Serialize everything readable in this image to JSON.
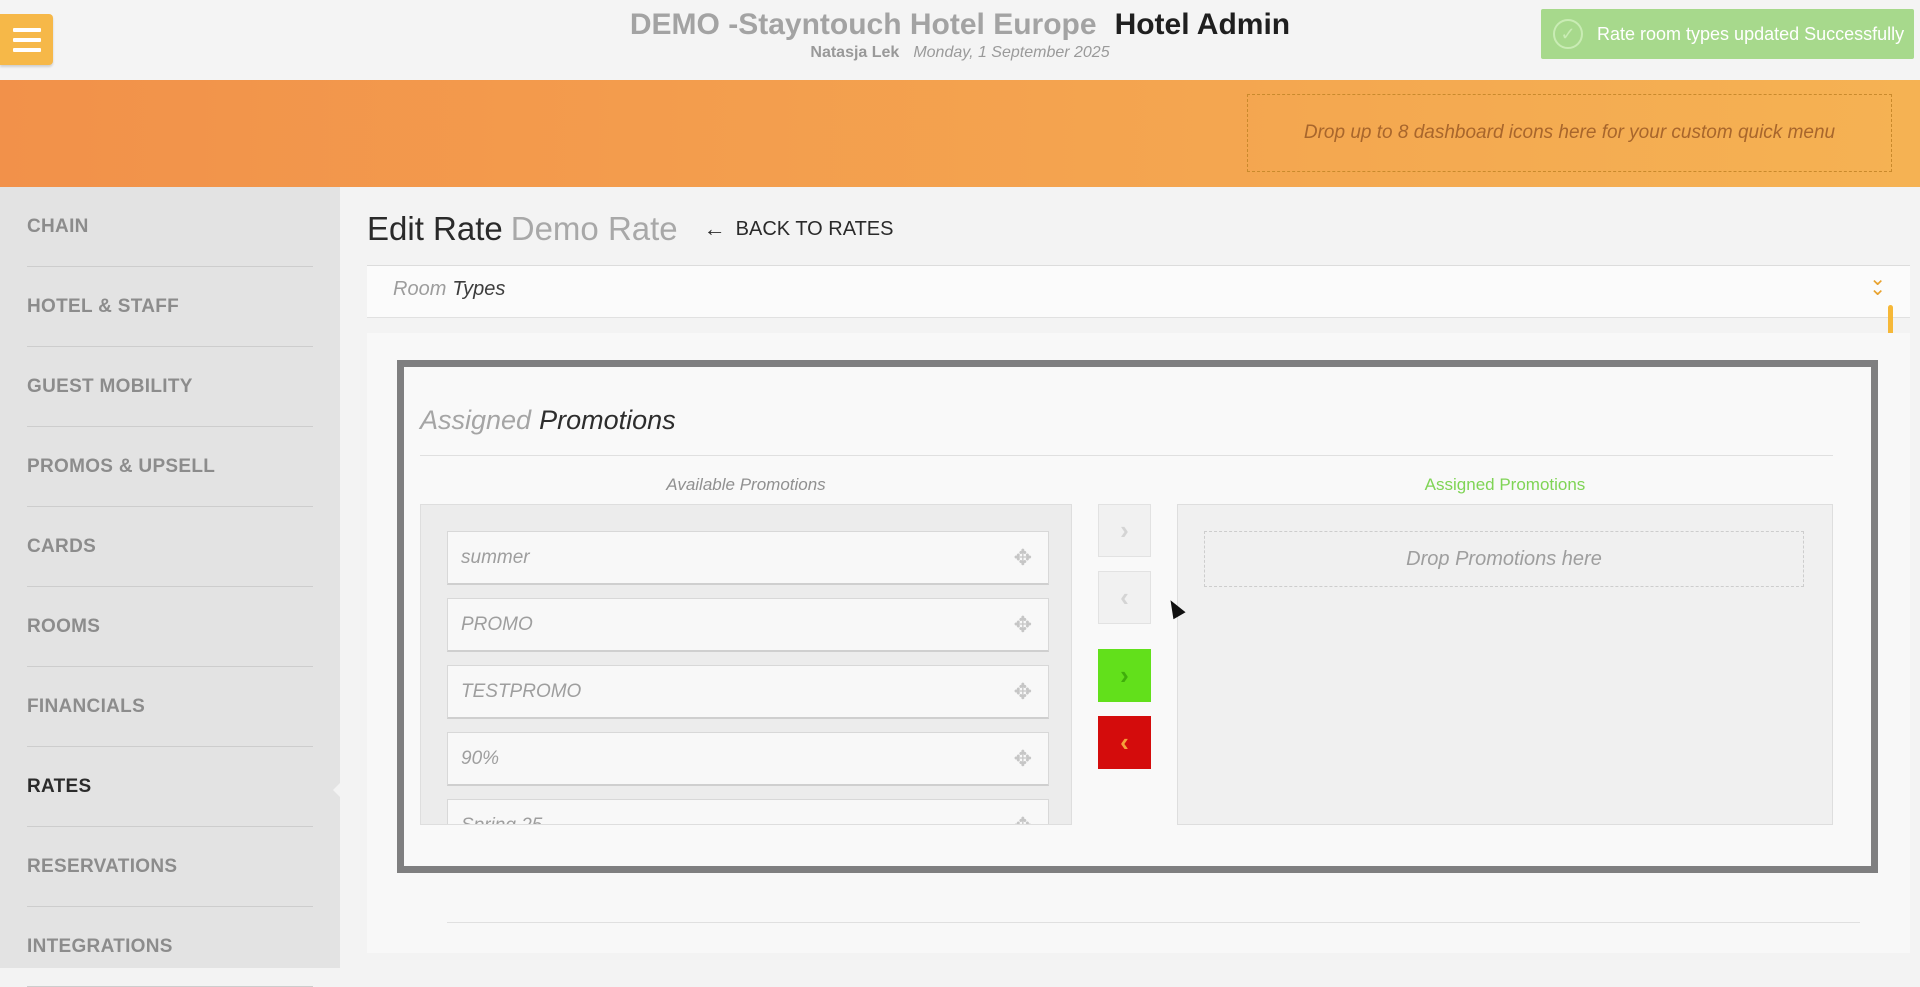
{
  "header": {
    "hotel_name": "DEMO -Stayntouch Hotel Europe",
    "app_name": "Hotel Admin",
    "user": "Natasja Lek",
    "date": "Monday, 1 September 2025"
  },
  "toast": {
    "message": "Rate room types updated Successfully"
  },
  "banner": {
    "dropzone_text": "Drop up to 8 dashboard icons here for your custom quick menu"
  },
  "sidebar": {
    "items": [
      {
        "label": "CHAIN"
      },
      {
        "label": "HOTEL & STAFF"
      },
      {
        "label": "GUEST MOBILITY"
      },
      {
        "label": "PROMOS & UPSELL"
      },
      {
        "label": "CARDS"
      },
      {
        "label": "ROOMS"
      },
      {
        "label": "FINANCIALS"
      },
      {
        "label": "RATES"
      },
      {
        "label": "RESERVATIONS"
      },
      {
        "label": "INTEGRATIONS"
      }
    ],
    "active": "RATES"
  },
  "page": {
    "title": "Edit Rate",
    "rate_name": "Demo Rate",
    "back_label": "BACK TO RATES"
  },
  "room_types": {
    "label_a": "Room",
    "label_b": "Types"
  },
  "promotions": {
    "title_a": "Assigned",
    "title_b": "Promotions",
    "available_label": "Available Promotions",
    "assigned_label": "Assigned Promotions",
    "available": [
      "summer",
      "PROMO",
      "TESTPROMO",
      "90%",
      "Spring 25"
    ],
    "drop_text": "Drop Promotions here"
  },
  "colors": {
    "accent_orange": "#f5b253",
    "assigned_green": "#7fd455",
    "add_all_button": "#62e01b",
    "remove_all_button": "#d40c0c",
    "toast_bg": "#a7d98c"
  },
  "icons": {
    "menu": "hamburger-icon",
    "toast": "check-circle-icon",
    "back": "arrow-left-icon",
    "expand": "chevron-double-down-icon",
    "move": "move-icon",
    "add": "chevron-right-icon",
    "remove": "chevron-left-icon"
  }
}
